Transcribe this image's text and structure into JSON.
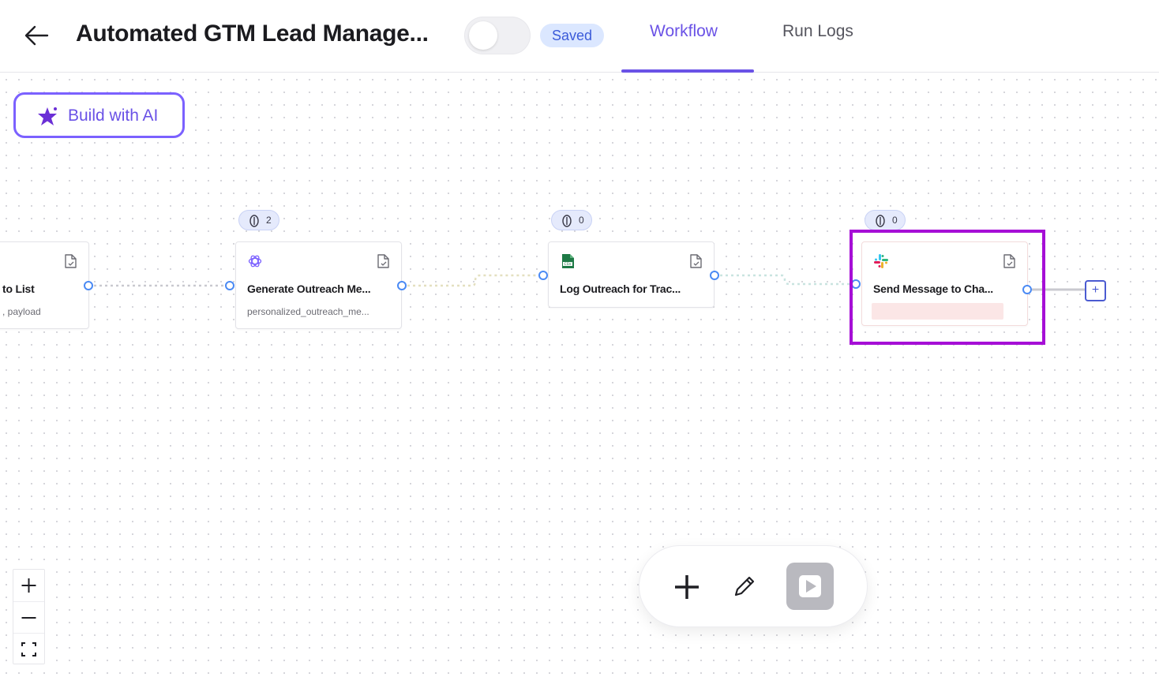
{
  "header": {
    "back_icon": "arrow-left-icon",
    "title": "Automated GTM Lead Manage...",
    "status_badge": "Saved",
    "tabs": [
      {
        "label": "Workflow",
        "active": true
      },
      {
        "label": "Run Logs",
        "active": false
      }
    ],
    "accent_color": "#6a52e6"
  },
  "canvas": {
    "build_ai": {
      "label": "Build with AI",
      "icon": "sparkle-icon"
    },
    "nodes": [
      {
        "title": "to List",
        "subtitle": ", payload",
        "icon": "none",
        "badge": ""
      },
      {
        "title": "Generate Outreach Me...",
        "subtitle": "personalized_outreach_me...",
        "icon": "openai-icon",
        "badge": "2"
      },
      {
        "title": "Log Outreach for Trac...",
        "subtitle": "",
        "icon": "csv-file-icon",
        "badge": "0"
      },
      {
        "title": "Send Message to Cha...",
        "subtitle": "",
        "icon": "slack-icon",
        "badge": "0",
        "highlighted": true
      }
    ],
    "highlight_color": "#a60fd6",
    "add_next_label": "+"
  },
  "zoom_controls": [
    "zoom-in-icon",
    "zoom-out-icon",
    "fit-view-icon"
  ],
  "toolbar": [
    "plus-icon",
    "pencil-icon",
    "play-icon"
  ]
}
